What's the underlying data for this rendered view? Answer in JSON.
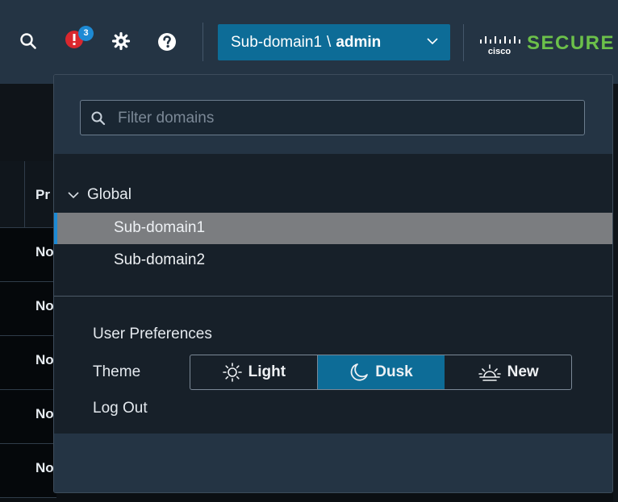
{
  "header": {
    "notifications_count": "3",
    "domain_selector": {
      "domain": "Sub-domain1",
      "separator": "\\",
      "user": "admin"
    },
    "brand": {
      "logo_text": "cisco",
      "product": "SECURE"
    },
    "colors": {
      "bar_bg": "#243444",
      "accent": "#0d6c97",
      "badge": "#1d8ad4",
      "alert_red": "#d9272e",
      "brand_green": "#6cc04a"
    },
    "icons": [
      "search-icon",
      "alert-icon",
      "gear-icon",
      "help-icon",
      "chevron-down-icon",
      "cisco-logo"
    ]
  },
  "background_table": {
    "header_text": "Pr",
    "row_texts": [
      "No",
      "No",
      "No",
      "No",
      "No"
    ]
  },
  "popover": {
    "filter_placeholder": "Filter domains",
    "tree": {
      "root_label": "Global",
      "items": [
        {
          "label": "Sub-domain1",
          "selected": true
        },
        {
          "label": "Sub-domain2",
          "selected": false
        }
      ]
    },
    "preferences": {
      "user_preferences_label": "User Preferences",
      "theme_label": "Theme",
      "theme_options": [
        {
          "label": "Light",
          "icon": "sun-icon",
          "active": false
        },
        {
          "label": "Dusk",
          "icon": "moon-icon",
          "active": true
        },
        {
          "label": "New",
          "icon": "sunrise-icon",
          "active": false
        }
      ],
      "logout_label": "Log Out"
    }
  }
}
